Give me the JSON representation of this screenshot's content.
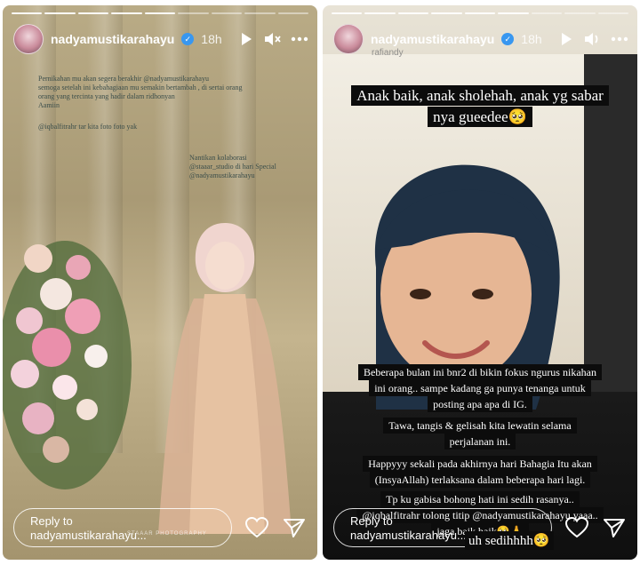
{
  "left_story": {
    "username": "nadyamustikarahayu",
    "time": "18h",
    "caption_lines": [
      "Pernikahan mu akan segera berakhir @nadyamustikarahayu",
      "semoga setelah ini kebahagiaan mu semakin bertambah , di sertai orang",
      "orang yang tercinta yang hadir dalam ridhonyan",
      "Aamiin",
      "@iqbalfitrahr tar kita foto foto yak"
    ],
    "collab_lines": [
      "Nantikan kolaborasi",
      "@staaar_studio di hari Special",
      "@nadyamustikarahayu"
    ],
    "watermark": "STAAAR PHOTOGRAPHY",
    "reply_line1": "Reply to",
    "reply_line2": "nadyamustikarahayu..."
  },
  "right_story": {
    "username": "nadyamustikarahayu",
    "time": "18h",
    "mention_behind": "rafiandy",
    "headline_lines": [
      "Anak baik, anak sholehah, anak yg sabar",
      "nya gueedee🥺"
    ],
    "body_block1": [
      "Beberapa bulan ini bnr2 di bikin fokus ngurus nikahan",
      "ini orang.. sampe kadang ga punya tenanga untuk",
      "posting apa apa di IG."
    ],
    "body_block2": [
      "Tawa, tangis & gelisah kita lewatin selama",
      "perjalanan ini."
    ],
    "body_block3": [
      "Happyyy sekali pada akhirnya hari Bahagia Itu akan",
      "(InsyaAllah) terlaksana dalam beberapa hari lagi."
    ],
    "body_block4": [
      "Tp ku gabisa bohong hati ini sedih rasanya..",
      "@iqbalfitrahr tolong titip @nadyamustikarahayu yaaa..",
      "jaga baik baik🥺🙏"
    ],
    "footer_overlay": "uh sedihhhh🥺",
    "reply_line1": "Reply to",
    "reply_line2": "nadyamustikarahayu..."
  },
  "icons": {
    "play": "play-icon",
    "mute": "mute-icon",
    "more": "more-icon",
    "heart": "heart-icon",
    "send": "send-icon"
  },
  "colors": {
    "verified_blue": "#3897f0",
    "caption_box": "#0c0c0c"
  }
}
